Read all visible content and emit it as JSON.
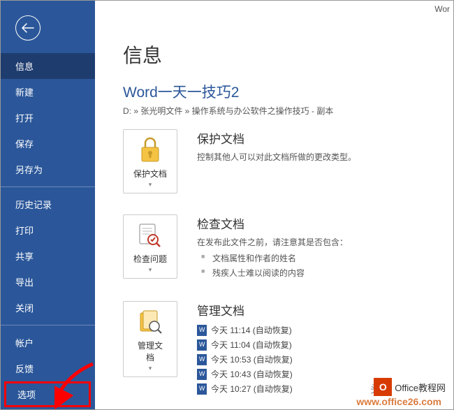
{
  "app_title": "Wor",
  "page_title": "信息",
  "doc_title": "Word一天一技巧2",
  "doc_path": "D: » 张光明文件 » 操作系统与办公软件之操作技巧 - 副本",
  "sidebar": {
    "items": [
      {
        "label": "信息",
        "selected": true
      },
      {
        "label": "新建"
      },
      {
        "label": "打开"
      },
      {
        "label": "保存"
      },
      {
        "label": "另存为"
      },
      {
        "label": "历史记录"
      },
      {
        "label": "打印"
      },
      {
        "label": "共享"
      },
      {
        "label": "导出"
      },
      {
        "label": "关闭"
      },
      {
        "label": "帐户"
      },
      {
        "label": "反馈"
      },
      {
        "label": "选项",
        "highlighted": true
      }
    ]
  },
  "protect": {
    "card_label": "保护文档",
    "heading": "保护文档",
    "desc": "控制其他人可以对此文档所做的更改类型。"
  },
  "inspect": {
    "card_label": "检查问题",
    "heading": "检查文档",
    "desc": "在发布此文件之前，请注意其是否包含：",
    "bullets": [
      "文档属性和作者的姓名",
      "残疾人士难以阅读的内容"
    ]
  },
  "manage": {
    "card_label": "管理文\n档",
    "heading": "管理文档",
    "recoveries": [
      "今天 11:14 (自动恢复)",
      "今天 11:04 (自动恢复)",
      "今天 10:53 (自动恢复)",
      "今天 10:43 (自动恢复)",
      "今天 10:27 (自动恢复)"
    ]
  },
  "watermark1": "头条",
  "office_logo_text": "Office教程网",
  "watermark2": "www.office26.com"
}
